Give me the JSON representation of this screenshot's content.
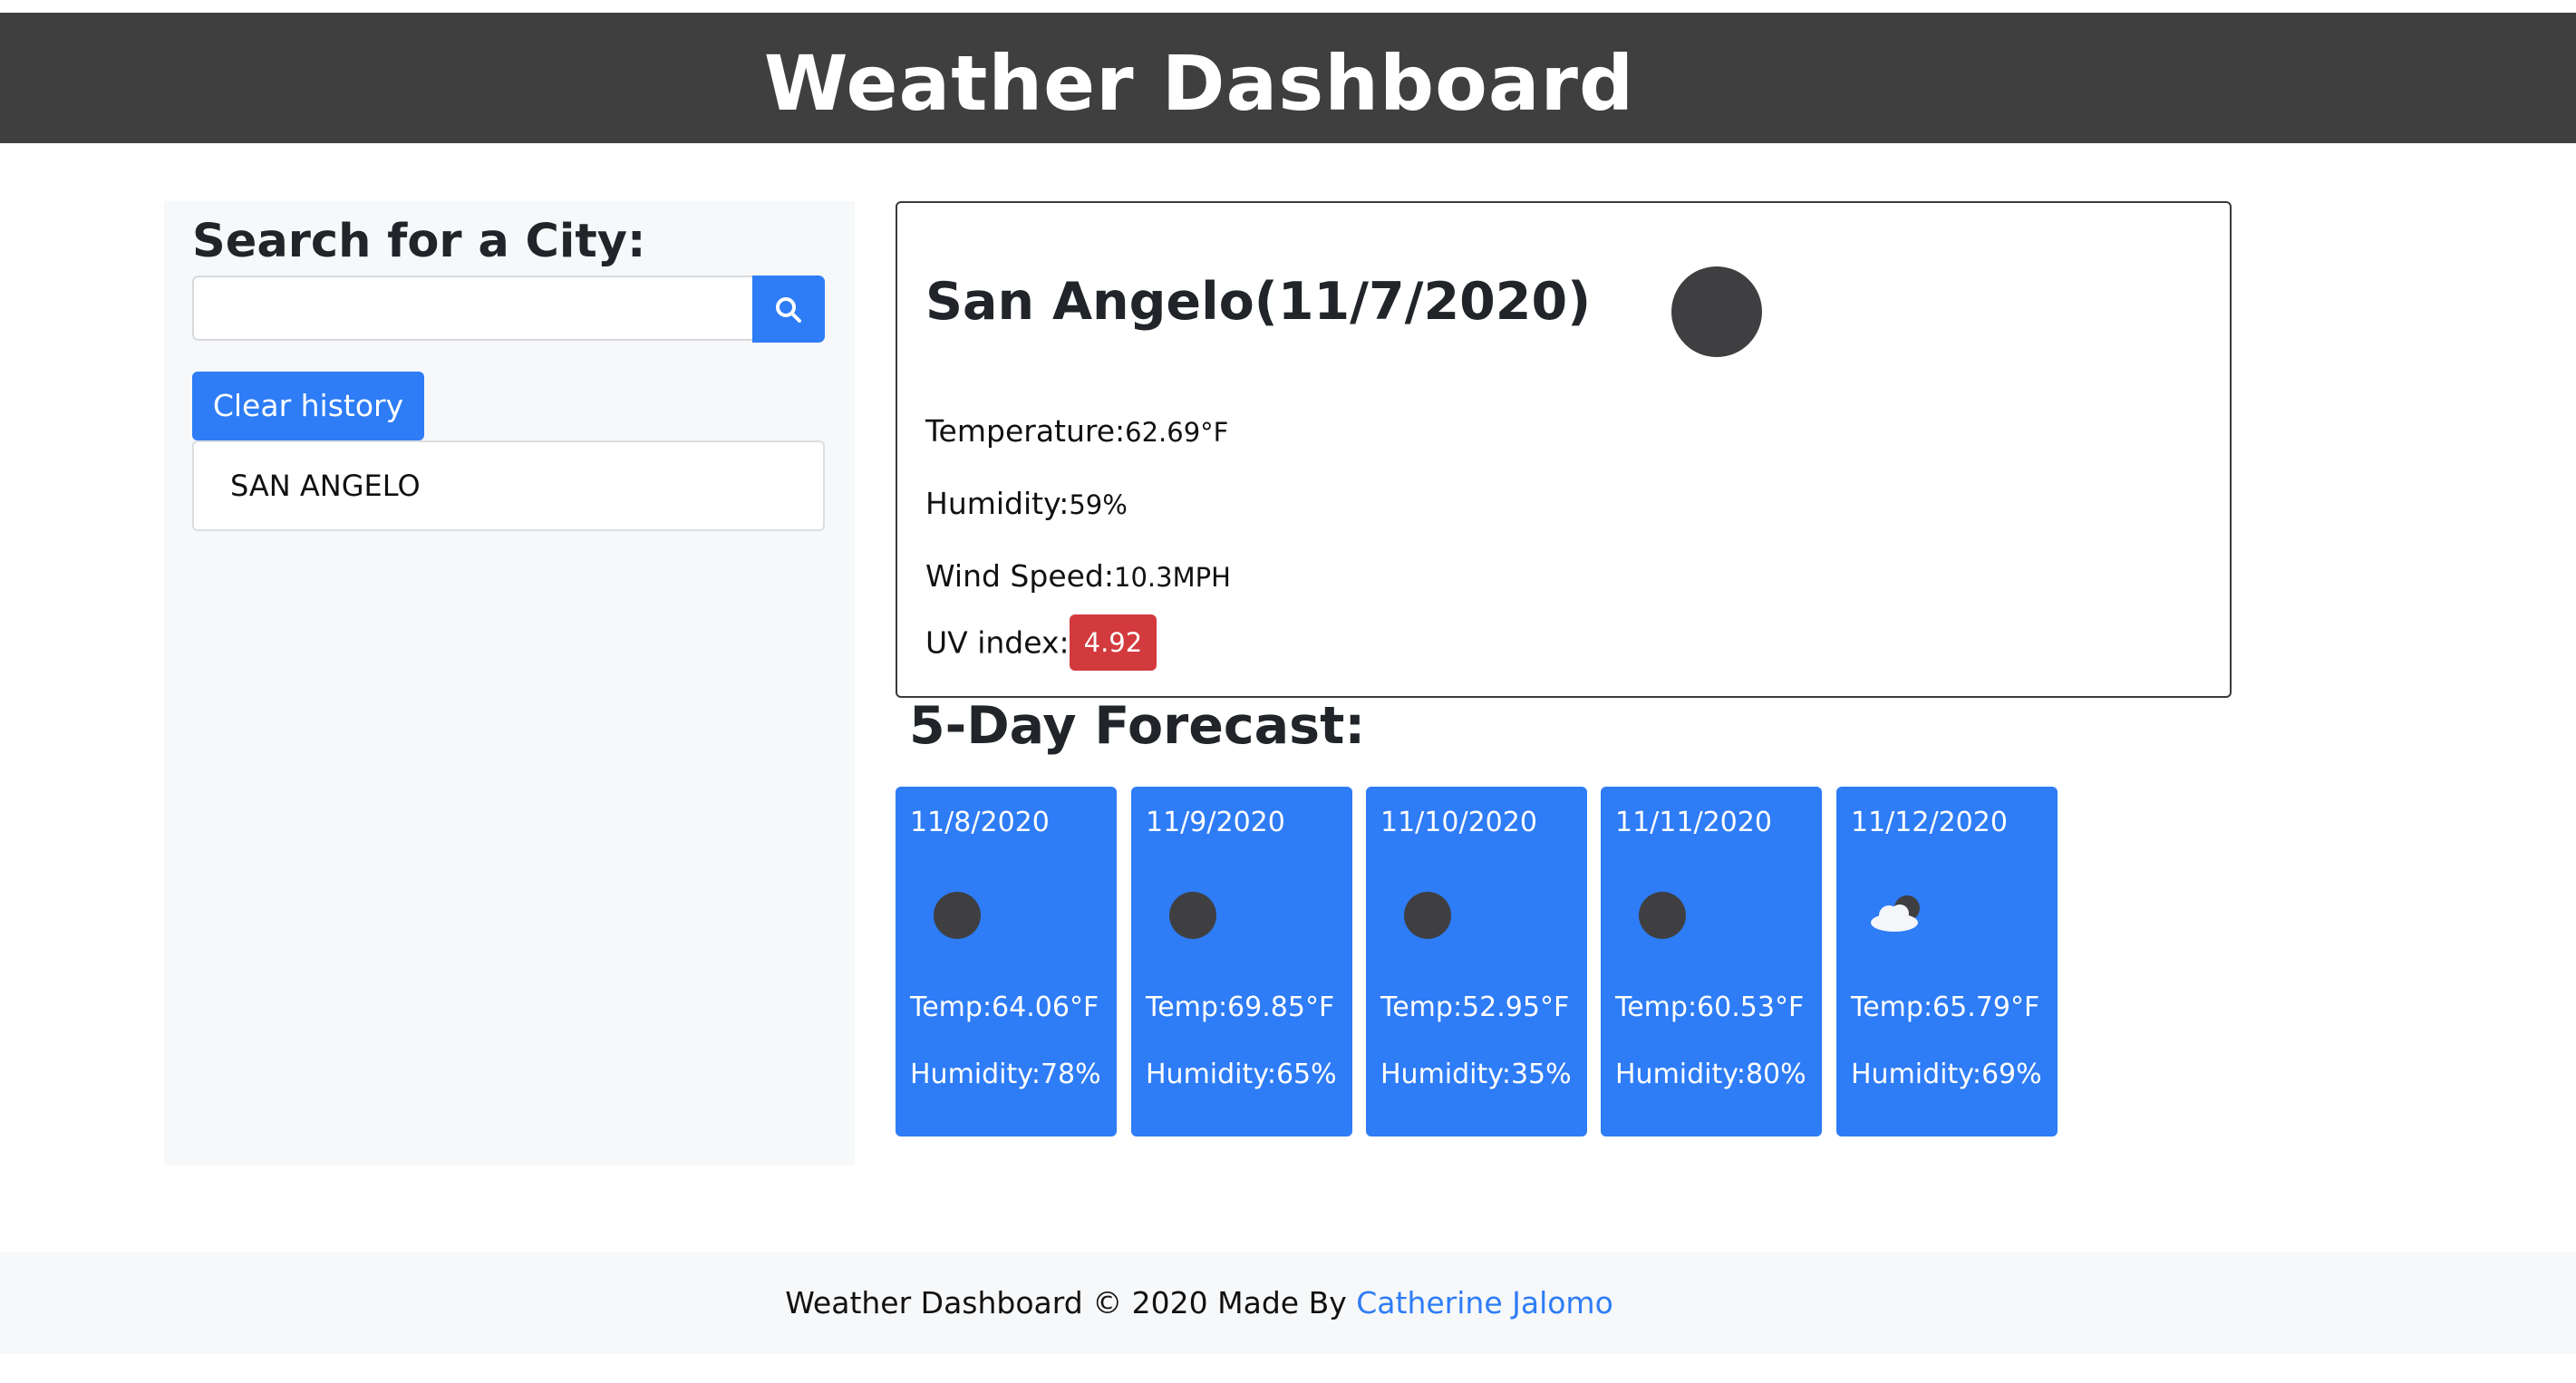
{
  "header": {
    "title": "Weather Dashboard"
  },
  "sidebar": {
    "search_title": "Search for a City:",
    "search_input": {
      "value": "",
      "placeholder": ""
    },
    "search_icon": "search-icon",
    "clear_label": "Clear history",
    "history": [
      "SAN ANGELO"
    ]
  },
  "current": {
    "city_title": "San Angelo(11/7/2020)",
    "icon": "night-clear-icon",
    "temperature_label": "Temperature:",
    "temperature_value": "62.69°F",
    "humidity_label": "Humidity:",
    "humidity_value": "59%",
    "wind_label": "Wind Speed:",
    "wind_value": "10.3MPH",
    "uv_label": "UV index:",
    "uv_value": "4.92",
    "uv_color": "#d23a3e"
  },
  "forecast": {
    "title": "5-Day Forecast:",
    "days": [
      {
        "date": "11/8/2020",
        "icon": "night-clear-icon",
        "temp": "Temp:64.06°F",
        "humidity": "Humidity:78%"
      },
      {
        "date": "11/9/2020",
        "icon": "night-clear-icon",
        "temp": "Temp:69.85°F",
        "humidity": "Humidity:65%"
      },
      {
        "date": "11/10/2020",
        "icon": "night-clear-icon",
        "temp": "Temp:52.95°F",
        "humidity": "Humidity:35%"
      },
      {
        "date": "11/11/2020",
        "icon": "night-clear-icon",
        "temp": "Temp:60.53°F",
        "humidity": "Humidity:80%"
      },
      {
        "date": "11/12/2020",
        "icon": "night-partly-cloudy-icon",
        "temp": "Temp:65.79°F",
        "humidity": "Humidity:69%"
      }
    ]
  },
  "footer": {
    "text": "Weather Dashboard © 2020 Made By ",
    "author": "Catherine Jalomo"
  },
  "colors": {
    "header_bg": "#3f3f3f",
    "primary": "#2e7cf6",
    "uv": "#d23a3e",
    "panel_bg": "#f7f8f9"
  }
}
